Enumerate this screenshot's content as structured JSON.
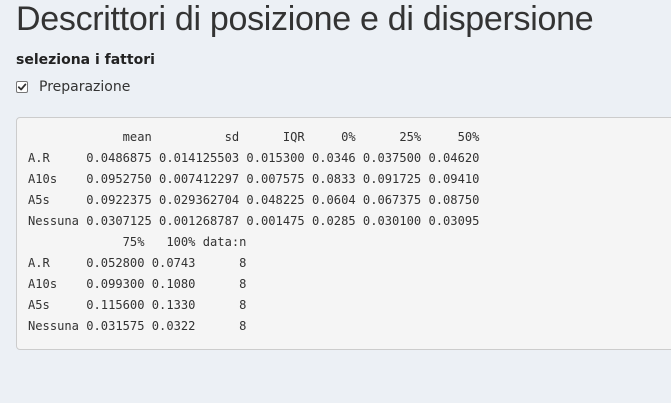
{
  "page": {
    "title": "Descrittori di posizione e di dispersione"
  },
  "factors": {
    "label": "seleziona i fattori",
    "options": [
      {
        "label": "Preparazione",
        "checked": true
      }
    ]
  },
  "output": {
    "lines": [
      "             mean          sd      IQR     0%      25%     50%",
      "A.R     0.0486875 0.014125503 0.015300 0.0346 0.037500 0.04620",
      "A10s    0.0952750 0.007412297 0.007575 0.0833 0.091725 0.09410",
      "A5s     0.0922375 0.029362704 0.048225 0.0604 0.067375 0.08750",
      "Nessuna 0.0307125 0.001268787 0.001475 0.0285 0.030100 0.03095",
      "             75%   100% data:n",
      "A.R     0.052800 0.0743      8",
      "A10s    0.099300 0.1080      8",
      "A5s     0.115600 0.1330      8",
      "Nessuna 0.031575 0.0322      8"
    ]
  }
}
